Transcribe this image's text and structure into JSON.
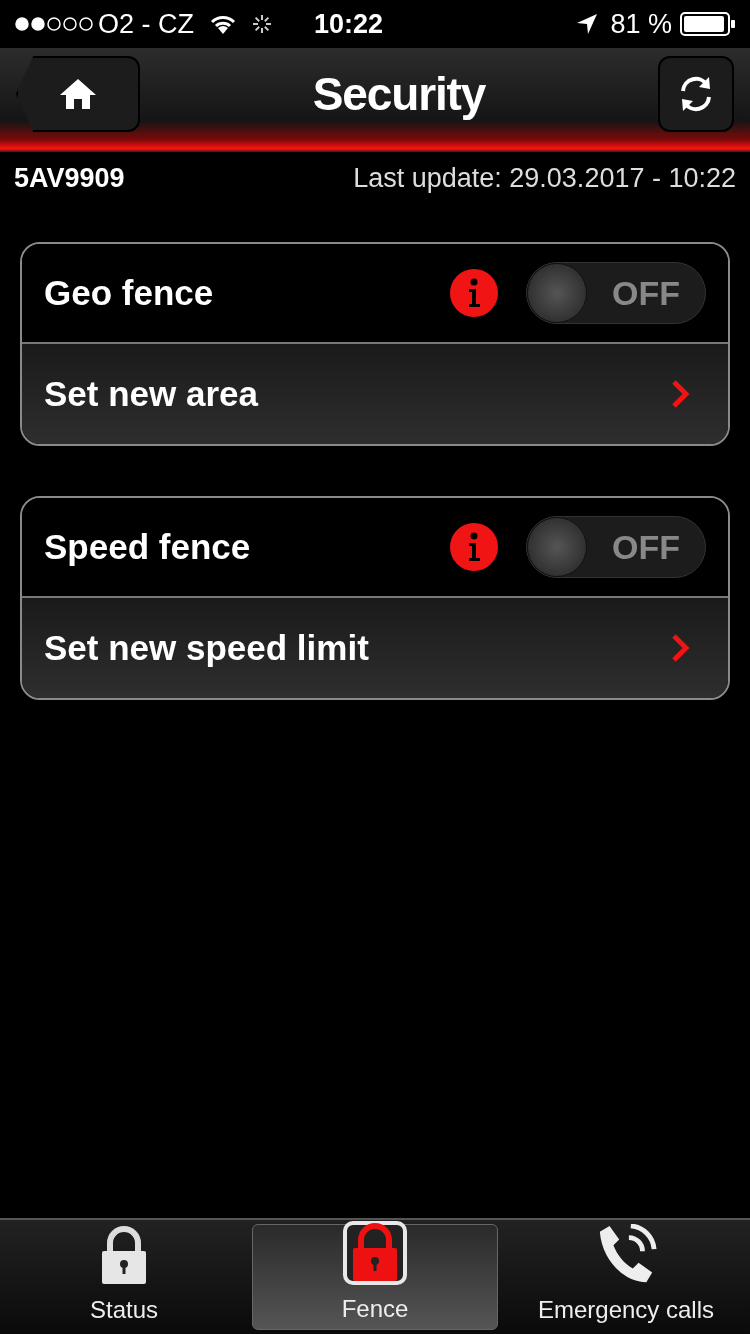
{
  "status_bar": {
    "carrier": "O2 - CZ",
    "time": "10:22",
    "battery": "81 %"
  },
  "header": {
    "title": "Security"
  },
  "info": {
    "vehicle": "5AV9909",
    "last_update": "Last update: 29.03.2017 - 10:22"
  },
  "sections": [
    {
      "toggle": {
        "label": "Geo fence",
        "on": false,
        "switch_text": "OFF"
      },
      "link": {
        "label": "Set new area"
      }
    },
    {
      "toggle": {
        "label": "Speed fence",
        "on": false,
        "switch_text": "OFF"
      },
      "link": {
        "label": "Set new speed limit"
      }
    }
  ],
  "tabs": [
    {
      "kind": "lock",
      "label": "Status",
      "selected": false
    },
    {
      "kind": "fence",
      "label": "Fence",
      "selected": true
    },
    {
      "kind": "phone",
      "label": "Emergency calls",
      "selected": false
    }
  ]
}
